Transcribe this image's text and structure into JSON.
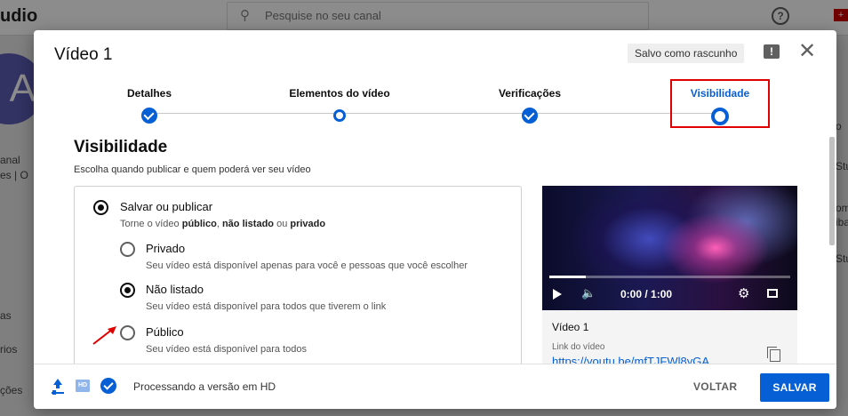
{
  "background": {
    "logo": "udio",
    "search_placeholder": "Pesquise no seu canal",
    "avatar_letter": "A",
    "left_fragments": [
      "anal",
      "es | O",
      "as",
      "rios",
      "ções"
    ],
    "right_fragments": [
      "o",
      "Stu",
      "om",
      "iba",
      "Stu"
    ]
  },
  "dialog": {
    "title": "Vídeo 1",
    "saved_label": "Salvo como rascunho",
    "steps": [
      {
        "label": "Detalhes",
        "state": "done"
      },
      {
        "label": "Elementos do vídeo",
        "state": "pending"
      },
      {
        "label": "Verificações",
        "state": "done"
      },
      {
        "label": "Visibilidade",
        "state": "current"
      }
    ]
  },
  "visibility": {
    "title": "Visibilidade",
    "subtitle": "Escolha quando publicar e quem poderá ver seu vídeo",
    "save_publish": {
      "label": "Salvar ou publicar",
      "desc_pre": "Torne o vídeo ",
      "desc_b1": "público",
      "desc_mid1": ", ",
      "desc_b2": "não listado",
      "desc_mid2": " ou ",
      "desc_b3": "privado"
    },
    "options": [
      {
        "label": "Privado",
        "desc": "Seu vídeo está disponível apenas para você e pessoas que você escolher",
        "selected": false
      },
      {
        "label": "Não listado",
        "desc": "Seu vídeo está disponível para todos que tiverem o link",
        "selected": true
      },
      {
        "label": "Público",
        "desc": "Seu vídeo está disponível para todos",
        "selected": false
      }
    ]
  },
  "preview": {
    "time": "0:00 / 1:00",
    "progress": 0.15,
    "title": "Vídeo 1",
    "link_label": "Link do vídeo",
    "link": "https://youtu.be/mfTJFWl8yGA"
  },
  "footer": {
    "hd_badge": "HD",
    "processing": "Processando a versão em HD",
    "back_label": "VOLTAR",
    "save_label": "SALVAR"
  },
  "colors": {
    "accent": "#065fd4",
    "highlight": "#e00000"
  }
}
